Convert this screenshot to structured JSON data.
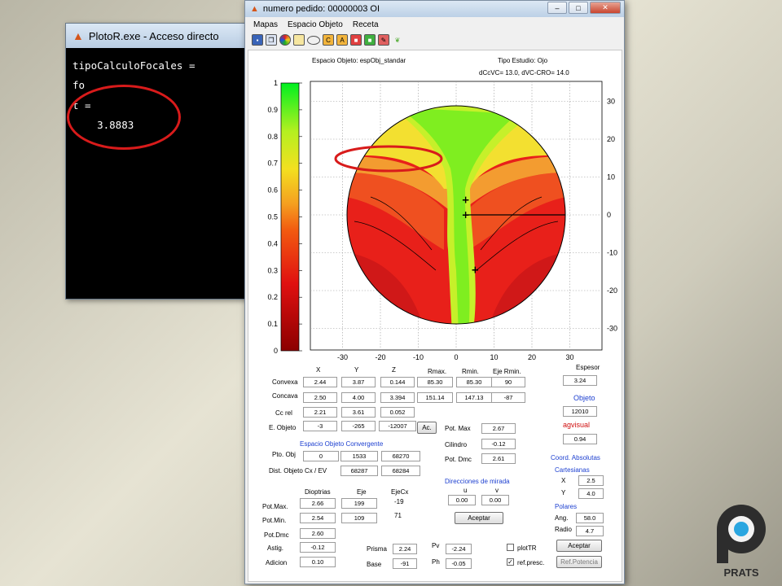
{
  "console": {
    "title": "PlotoR.exe - Acceso directo",
    "lines": [
      "tipoCalculoFocales =",
      "fo",
      "t =",
      "    3.8883"
    ]
  },
  "window": {
    "title": "numero pedido:  00000003 OI",
    "menu": [
      "Mapas",
      "Espacio Objeto",
      "Receta"
    ]
  },
  "header": {
    "space": "Espacio Objeto: espObj_standar",
    "study": "Tipo Estudio:   Ojo",
    "params": "dCcVC= 13.0, dVC-CRO= 14.0"
  },
  "chart_data": {
    "type": "heatmap",
    "colorbar": {
      "ticks": [
        "0",
        "0.1",
        "0.2",
        "0.3",
        "0.4",
        "0.5",
        "0.6",
        "0.7",
        "0.8",
        "0.9",
        "1"
      ],
      "range": [
        0,
        1
      ]
    },
    "x_ticks": [
      "-30",
      "-20",
      "-10",
      "0",
      "10",
      "20",
      "30"
    ],
    "y_ticks": [
      "30",
      "20",
      "10",
      "0",
      "-10",
      "-20",
      "-30"
    ],
    "xlim": [
      -30,
      30
    ],
    "ylim": [
      -30,
      30
    ],
    "grid": true,
    "markers": [
      [
        2.5,
        4
      ],
      [
        2.5,
        0
      ],
      [
        5,
        -14.5
      ]
    ]
  },
  "table": {
    "col_headers": [
      "X",
      "Y",
      "Z",
      "Rmax.",
      "Rmin.",
      "Eje Rmin."
    ],
    "rows": [
      {
        "label": "Convexa",
        "values": [
          "2.44",
          "3.87",
          "0.144",
          "85.30",
          "85.30",
          "90"
        ]
      },
      {
        "label": "Concava",
        "values": [
          "2.50",
          "4.00",
          "3.394",
          "151.14",
          "147.13",
          "-87"
        ]
      },
      {
        "label": "Cc rel",
        "values": [
          "2.21",
          "3.61",
          "0.052"
        ]
      },
      {
        "label": "E. Objeto",
        "values": [
          "-3",
          "-265",
          "-12007"
        ]
      }
    ],
    "ac_button": "Ac."
  },
  "right": {
    "espesor_label": "Espesor",
    "espesor": "3.24",
    "objeto_label": "Objeto",
    "objeto": "12010",
    "agvisual_label": "agvisual",
    "agvisual": "0.94",
    "coord_title": "Coord. Absolutas",
    "cart_title": "Cartesianas",
    "x_label": "X",
    "x": "2.5",
    "y_label": "Y",
    "y": "4.0",
    "polares_title": "Polares",
    "ang_label": "Ang.",
    "ang": "58.0",
    "radio_label": "Radio",
    "radio": "4.7",
    "aceptar": "Aceptar",
    "refpot": "Ref.Potencia"
  },
  "pot": {
    "max_label": "Pot. Max",
    "max": "2.67",
    "cil_label": "Cilindro",
    "cil": "-0.12",
    "dmc_label": "Pot. Dmc",
    "dmc": "2.61"
  },
  "converge": {
    "title": "Espacio Objeto Convergente",
    "pto_label": "Pto. Obj",
    "pto": [
      "0",
      "1533",
      "68270"
    ],
    "dist_label": "Dist. Objeto Cx / EV",
    "dist": [
      "68287",
      "68284"
    ]
  },
  "dirs": {
    "title": "Direcciones de mirada",
    "u_label": "u",
    "v_label": "v",
    "u": "0.00",
    "v": "0.00",
    "aceptar": "Aceptar"
  },
  "diop": {
    "headers": [
      "Dioptrias",
      "Eje",
      "EjeCx"
    ],
    "potmax_label": "Pot.Max.",
    "potmax": [
      "2.66",
      "199"
    ],
    "ejecx1": "-19",
    "potmin_label": "Pot.Min.",
    "potmin": [
      "2.54",
      "109"
    ],
    "ejecx2": "71",
    "potdmc_label": "Pot.Dmc",
    "potdmc": "2.60",
    "astig_label": "Astig.",
    "astig": "-0.12",
    "adicion_label": "Adicion",
    "adicion": "0.10"
  },
  "prism": {
    "prisma_label": "Prisma",
    "prisma": "2.24",
    "base_label": "Base",
    "base": "-91",
    "pv_label": "Pv",
    "pv": "-2.24",
    "ph_label": "Ph",
    "ph": "-0.05"
  },
  "checks": {
    "plottr": "plotTR",
    "refpresc": "ref.presc.",
    "refpresc_checked": true,
    "plottr_checked": false
  },
  "logo": {
    "text": "PRATS"
  },
  "colors": {
    "accent_blue": "#1c3fd0",
    "highlight_red": "#d81b1b",
    "logo_blue": "#2aa6e0",
    "logo_dark": "#2d2d2d"
  }
}
